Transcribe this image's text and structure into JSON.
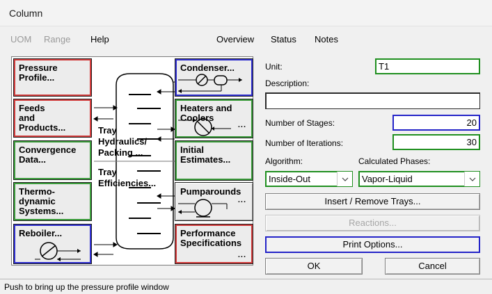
{
  "window": {
    "title": "Column"
  },
  "menu": {
    "left": [
      "UOM",
      "Range",
      "Help"
    ],
    "right": [
      "Overview",
      "Status",
      "Notes"
    ]
  },
  "pfd_tiles": {
    "pressure_profile": "Pressure\nProfile...",
    "feeds_products": "Feeds\nand\nProducts...",
    "convergence": "Convergence\nData...",
    "thermo": "Thermo-\ndynamic\nSystems...",
    "reboiler": "Reboiler...",
    "condenser": "Condenser...",
    "heaters_coolers": "Heaters and\n        Coolers",
    "initial_estimates": "Initial\nEstimates...",
    "pumparounds": "Pumparounds",
    "performance": "Performance\nSpecifications",
    "tray_hydraulics": "Tray\nHydraulics/\nPacking ...",
    "tray_efficiencies": "Tray\nEfficiencies...",
    "more_marker": "..."
  },
  "form": {
    "unit_label": "Unit:",
    "unit_value": "T1",
    "description_label": "Description:",
    "description_value": "",
    "stages_label": "Number of Stages:",
    "stages_value": "20",
    "iterations_label": "Number of Iterations:",
    "iterations_value": "30",
    "algorithm_label": "Algorithm:",
    "algorithm_value": "Inside-Out",
    "phases_label": "Calculated Phases:",
    "phases_value": "Vapor-Liquid"
  },
  "buttons": {
    "insert_remove": "Insert / Remove Trays...",
    "reactions": "Reactions...",
    "print_options": "Print Options...",
    "ok": "OK",
    "cancel": "Cancel"
  },
  "status": {
    "message": "Push to bring up the pressure profile window"
  },
  "colors": {
    "required_red": "#d23b3b",
    "optional_green": "#3a9b3a",
    "defined_blue": "#2f2fd0"
  }
}
